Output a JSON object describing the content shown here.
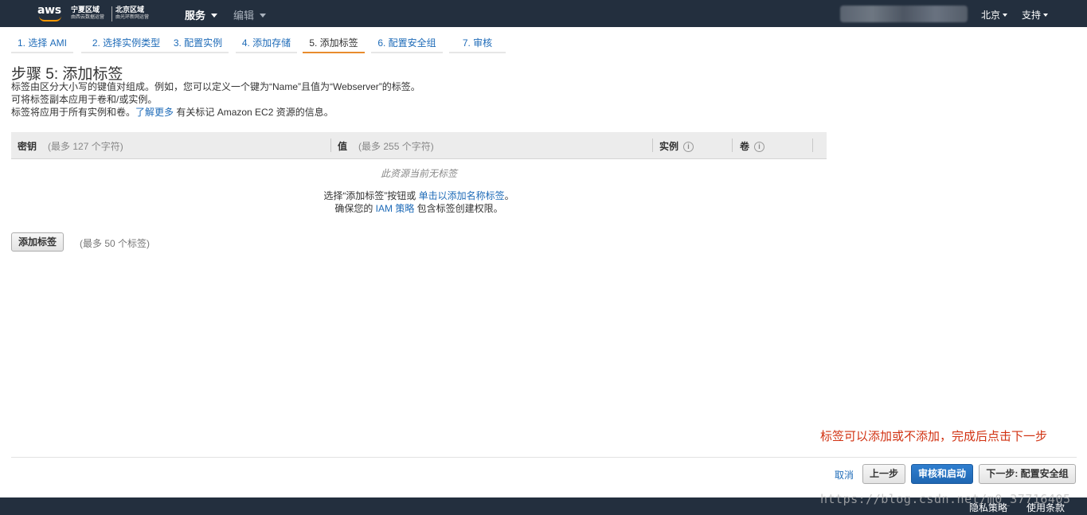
{
  "topnav": {
    "logo_text": "aws",
    "region_primary": {
      "title": "宁夏区域",
      "subtitle": "由西云数据运营"
    },
    "region_secondary": {
      "title": "北京区域",
      "subtitle": "由光环新网运营"
    },
    "services_label": "服务",
    "edit_label": "编辑",
    "region_menu": "北京",
    "support_menu": "支持"
  },
  "steps": [
    {
      "label": "1. 选择 AMI",
      "active": false
    },
    {
      "label": "2. 选择实例类型",
      "active": false
    },
    {
      "label": "3. 配置实例",
      "active": false
    },
    {
      "label": "4. 添加存储",
      "active": false
    },
    {
      "label": "5. 添加标签",
      "active": true
    },
    {
      "label": "6. 配置安全组",
      "active": false
    },
    {
      "label": "7. 审核",
      "active": false
    }
  ],
  "page": {
    "title": "步骤 5: 添加标签",
    "desc_line1": "标签由区分大小写的键值对组成。例如，您可以定义一个键为“Name”且值为“Webserver”的标签。",
    "desc_line2": "可将标签副本应用于卷和/或实例。",
    "desc_line3_prefix": "标签将应用于所有实例和卷。",
    "desc_line3_link": "了解更多",
    "desc_line3_suffix": " 有关标记 Amazon EC2 资源的信息。"
  },
  "table": {
    "col_key": "密钥",
    "col_key_hint": "(最多 127 个字符)",
    "col_value": "值",
    "col_value_hint": "(最多 255 个字符)",
    "col_instance": "实例",
    "col_volume": "卷",
    "info_glyph": "i",
    "empty_title": "此资源当前无标签",
    "empty_line1_prefix": "选择“添加标签”按钮或 ",
    "empty_line1_link": "单击以添加名称标签",
    "empty_line1_suffix": "。",
    "empty_line2_prefix": "确保您的 ",
    "empty_line2_link": "IAM 策略",
    "empty_line2_suffix": " 包含标签创建权限。"
  },
  "add_tag": {
    "button_label": "添加标签",
    "hint": "(最多 50 个标签)"
  },
  "annotation": "标签可以添加或不添加，完成后点击下一步",
  "footer_actions": {
    "cancel": "取消",
    "previous": "上一步",
    "review_launch": "审核和启动",
    "next": "下一步: 配置安全组"
  },
  "bottombar": {
    "privacy": "隐私策略",
    "terms": "使用条款",
    "watermark": "https://blog.csdn.net/m0_37716405"
  },
  "colors": {
    "nav_bg": "#232f3e",
    "accent": "#e88b2d",
    "link": "#1e6bb8",
    "primary": "#1f66b2",
    "annotation": "#d13212"
  }
}
